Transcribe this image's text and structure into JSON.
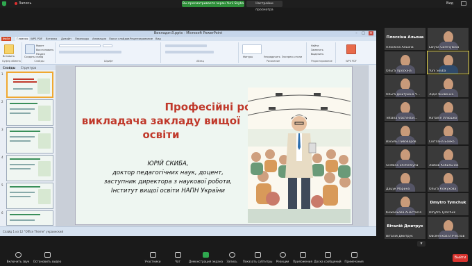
{
  "top": {
    "record_label": "Запись",
    "sharing_banner": "Вы просматриваете экран Yurii Skyba",
    "view_options": "Настройки просмотра",
    "view_label": "Вид"
  },
  "ppt": {
    "window_title": "Викладач3.pptx - Microsoft PowerPoint",
    "tabs": [
      "Файл",
      "Главная",
      "WPS PDF",
      "Вставка",
      "Дизайн",
      "Переходы",
      "Анимация",
      "Показ слайдов",
      "Рецензирование",
      "Вид"
    ],
    "ribbon_groups": [
      "Буфер обмена",
      "Слайды",
      "Шрифт",
      "Абзац",
      "Рисование",
      "Редактирование",
      "WPS PDF"
    ],
    "ribbon_buttons": {
      "paste": "Вставить",
      "create_slide": "Создать слайд",
      "layout": "Макет",
      "reset": "Восстановить",
      "section": "Раздел",
      "find": "Найти",
      "replace": "Заменить",
      "select": "Выделить",
      "shapes": "Фигуры",
      "arrange": "Упорядочить",
      "quick_styles": "Экспресс-стили"
    },
    "pane_tabs": [
      "Слайды",
      "Структура"
    ],
    "thumb_numbers": [
      "1",
      "2",
      "3",
      "4",
      "5",
      "6"
    ],
    "status_text": "Слайд 1 из 12   \"Office Theme\"   украинский",
    "slide": {
      "title_lines": [
        "Професійні ролі",
        "викладача закладу вищої",
        "освіти"
      ],
      "author_lines": [
        "ЮРІЙ СКИБА,",
        "доктор педагогічних наук, доцент,",
        "заступник директора з наукової роботи,",
        "Інститут вищої освіти НАПН України"
      ]
    }
  },
  "gallery": [
    {
      "name": "Плоскіна Альона",
      "display": "Плоскіна Альона",
      "type": "name"
    },
    {
      "name": "Larysa Gorenykova",
      "display": "",
      "type": "video"
    },
    {
      "name": "Ольга Проскіна",
      "display": "",
      "type": "video"
    },
    {
      "name": "Yurii Skyba",
      "display": "",
      "type": "video"
    },
    {
      "name": "Ольга Дмитрівна Ч...",
      "display": "",
      "type": "video"
    },
    {
      "name": "Лідія Яковенко",
      "display": "",
      "type": "video"
    },
    {
      "name": "Tetiana Viacheslav...",
      "display": "",
      "type": "video"
    },
    {
      "name": "Наталія Іллюшко",
      "display": "",
      "type": "video"
    },
    {
      "name": "Василь Пивоваров",
      "display": "",
      "type": "video"
    },
    {
      "name": "Світлана Бойко",
      "display": "",
      "type": "video"
    },
    {
      "name": "Svitlana Shcherbyna",
      "display": "",
      "type": "video"
    },
    {
      "name": "Любов Кобильник",
      "display": "",
      "type": "video"
    },
    {
      "name": "Дацук Марина",
      "display": "",
      "type": "video"
    },
    {
      "name": "Ольга Кожухова",
      "display": "",
      "type": "video"
    },
    {
      "name": "Кожальова Анастасія",
      "display": "",
      "type": "video"
    },
    {
      "name": "Dmytro Tymchuk",
      "display": "Dmytro Tymchuk",
      "type": "name"
    },
    {
      "name": "Віталій Дмитрук",
      "display": "Віталій Дмитрук",
      "type": "name"
    },
    {
      "name": "Овсянніков В'ячеслав",
      "display": "",
      "type": "video"
    }
  ],
  "toolbar": [
    {
      "label": "Включить звук",
      "icon": "mic-muted-icon"
    },
    {
      "label": "Остановить видео",
      "icon": "video-icon"
    },
    {
      "label": "Участники",
      "icon": "participants-icon",
      "count": "32"
    },
    {
      "label": "Чат",
      "icon": "chat-icon",
      "count": "1"
    },
    {
      "label": "Демонстрация экрана",
      "icon": "share-screen-icon"
    },
    {
      "label": "Запись",
      "icon": "record-icon"
    },
    {
      "label": "Показать субтитры",
      "icon": "captions-icon"
    },
    {
      "label": "Реакции",
      "icon": "reactions-icon"
    },
    {
      "label": "Приложения",
      "icon": "apps-icon"
    },
    {
      "label": "Доска сообщений",
      "icon": "whiteboard-icon"
    },
    {
      "label": "Примечания",
      "icon": "notes-icon"
    }
  ],
  "end_label": "Выйти",
  "colors": {
    "share_green": "#2fa84f",
    "end_red": "#d9332e",
    "slide_title": "#c0392b",
    "file_tab": "#d24726"
  }
}
